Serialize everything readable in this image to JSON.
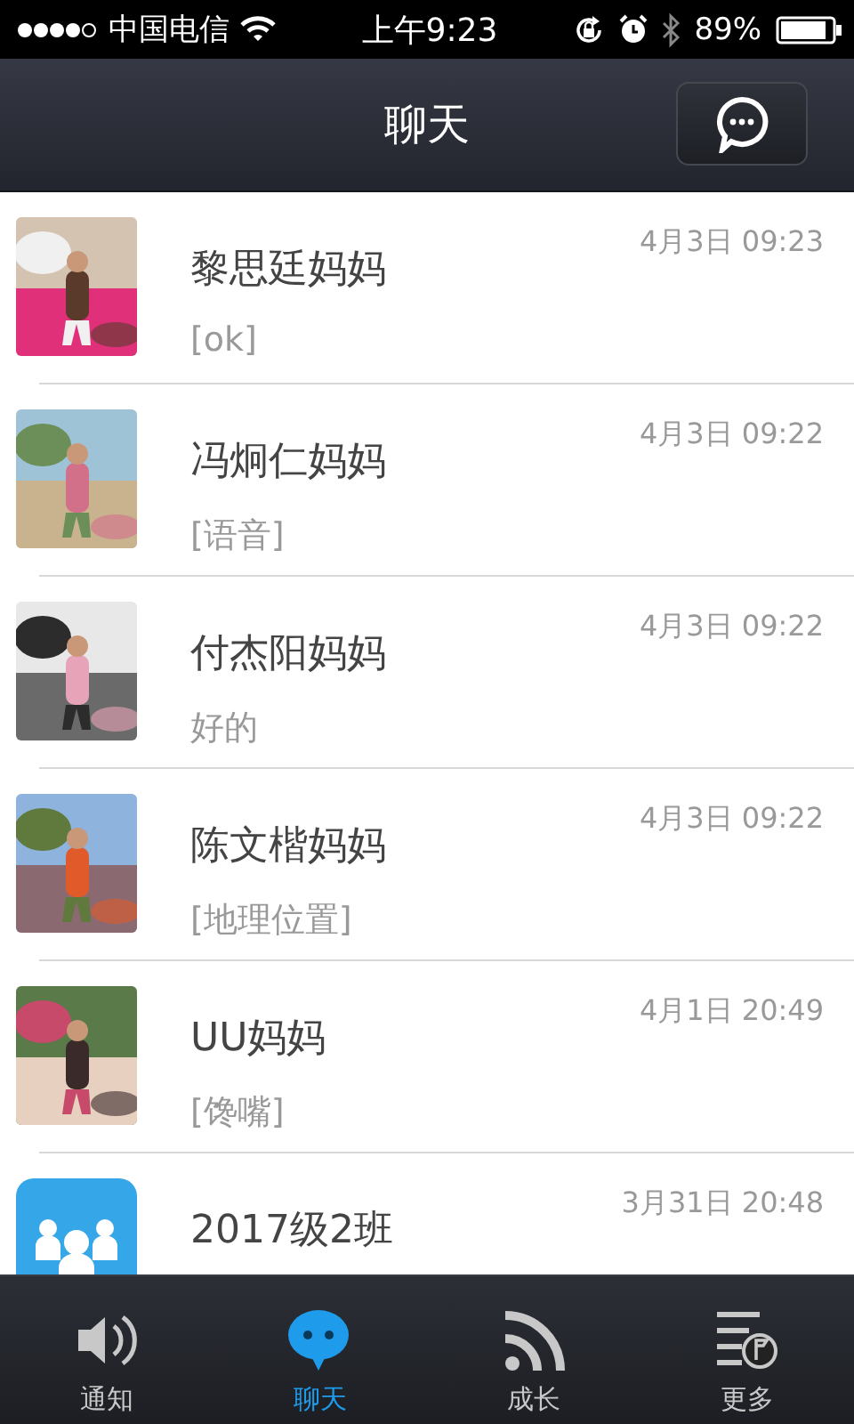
{
  "status_bar": {
    "carrier": "中国电信",
    "time": "上午9:23",
    "battery": "89%"
  },
  "nav_bar": {
    "title": "聊天"
  },
  "chats": [
    {
      "kind": "picture",
      "name": "黎思廷妈妈",
      "time": "4月3日 09:23",
      "preview": "[ok]"
    },
    {
      "kind": "picture",
      "name": "冯炯仁妈妈",
      "time": "4月3日 09:22",
      "preview": "[语音]"
    },
    {
      "kind": "picture",
      "name": "付杰阳妈妈",
      "time": "4月3日 09:22",
      "preview": "好的"
    },
    {
      "kind": "picture",
      "name": "陈文楷妈妈",
      "time": "4月3日 09:22",
      "preview": "[地理位置]"
    },
    {
      "kind": "picture",
      "name": "UU妈妈",
      "time": "4月1日 20:49",
      "preview": "[馋嘴]"
    },
    {
      "kind": "group",
      "name": "2017级2班",
      "time": "3月31日 20:48"
    }
  ],
  "tabs": [
    {
      "kind": "speaker",
      "label": "通知",
      "selected": false
    },
    {
      "kind": "chat",
      "label": "聊天",
      "selected": true
    },
    {
      "kind": "feed",
      "label": "成长",
      "selected": false
    },
    {
      "kind": "more",
      "label": "更多",
      "selected": false
    }
  ]
}
